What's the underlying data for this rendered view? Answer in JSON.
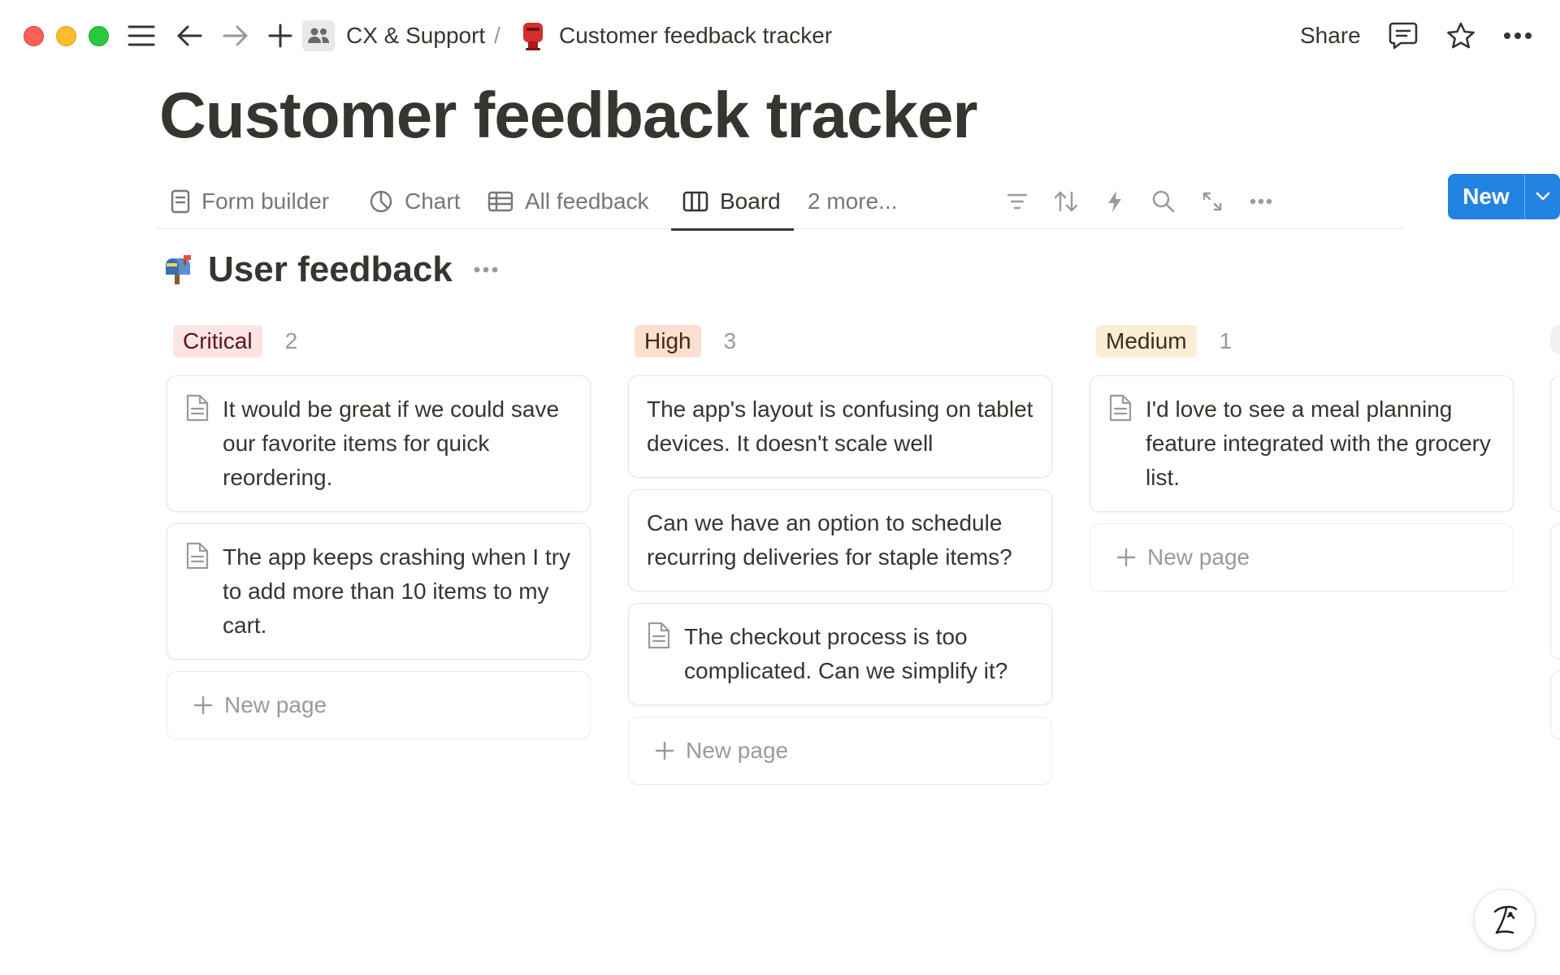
{
  "window": {
    "traffic_lights": [
      "close",
      "minimize",
      "maximize"
    ]
  },
  "breadcrumb": {
    "workspace": "CX & Support",
    "separator": "/",
    "page_icon": "postbox-emoji",
    "page": "Customer feedback tracker"
  },
  "topbar": {
    "share_label": "Share",
    "icons": [
      "sidebar-menu-icon",
      "back-arrow-icon",
      "forward-arrow-icon",
      "plus-icon",
      "people-icon",
      "comment-icon",
      "star-icon",
      "more-horizontal-icon"
    ]
  },
  "page": {
    "title": "Customer feedback tracker"
  },
  "views": {
    "tabs": [
      {
        "label": "Form builder",
        "icon": "form-icon"
      },
      {
        "label": "Chart",
        "icon": "chart-icon"
      },
      {
        "label": "All feedback",
        "icon": "table-icon"
      },
      {
        "label": "Board",
        "icon": "board-icon",
        "active": true
      }
    ],
    "more_label": "2 more...",
    "tools": [
      "filter-icon",
      "sort-icon",
      "automation-bolt-icon",
      "search-icon",
      "expand-icon",
      "more-horizontal-icon"
    ],
    "new_label": "New"
  },
  "board": {
    "icon": "mailbox-emoji",
    "title": "User feedback",
    "new_page_label": "New page",
    "columns": [
      {
        "tag": "Critical",
        "count": "2",
        "color": "#fbe4e4",
        "cards": [
          "It would be great if we could save our favorite items for quick reordering.",
          "The app keeps crashing when I try to add more than 10 items to my cart."
        ]
      },
      {
        "tag": "High",
        "count": "3",
        "color": "#fae0d0",
        "cards": [
          "The app's layout is confusing on tablet devices. It doesn't scale well",
          "Can we have an option to schedule recurring deliveries for staple items?",
          "The checkout process is too complicated. Can we simplify it?"
        ]
      },
      {
        "tag": "Medium",
        "count": "1",
        "color": "#fbedd6",
        "cards": [
          "I'd love to see a meal planning feature integrated with the grocery list."
        ]
      }
    ]
  },
  "colors": {
    "accent": "#2383e2",
    "text": "#37352f",
    "muted": "#9b9a97"
  },
  "help": {
    "icon": "help-signature-icon"
  }
}
